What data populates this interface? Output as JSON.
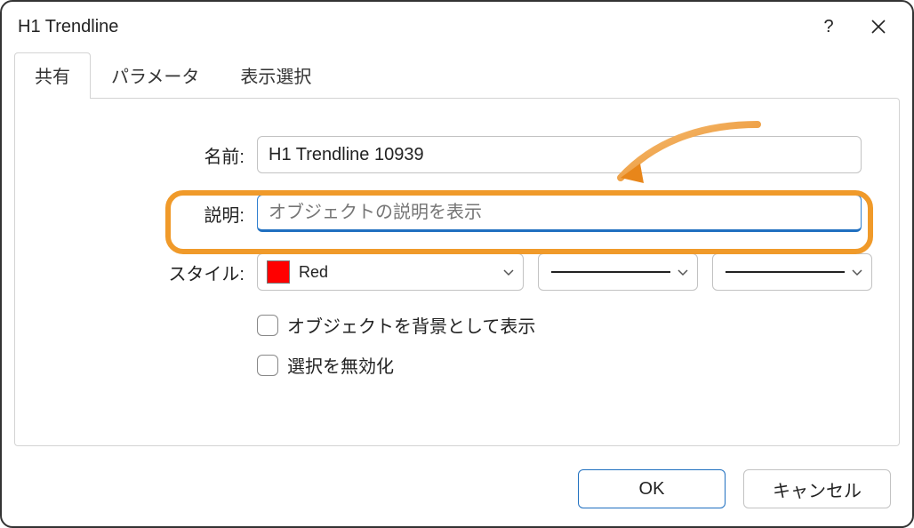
{
  "title": "H1 Trendline",
  "tabs": {
    "common": "共有",
    "parameters": "パラメータ",
    "display": "表示選択"
  },
  "labels": {
    "name": "名前:",
    "description": "説明:",
    "style": "スタイル:"
  },
  "name_value": "H1 Trendline 10939",
  "description_placeholder": "オブジェクトの説明を表示",
  "style_color_name": "Red",
  "style_color_hex": "#ff0000",
  "checkboxes": {
    "draw_as_background": "オブジェクトを背景として表示",
    "disable_selection": "選択を無効化"
  },
  "buttons": {
    "ok": "OK",
    "cancel": "キャンセル"
  }
}
